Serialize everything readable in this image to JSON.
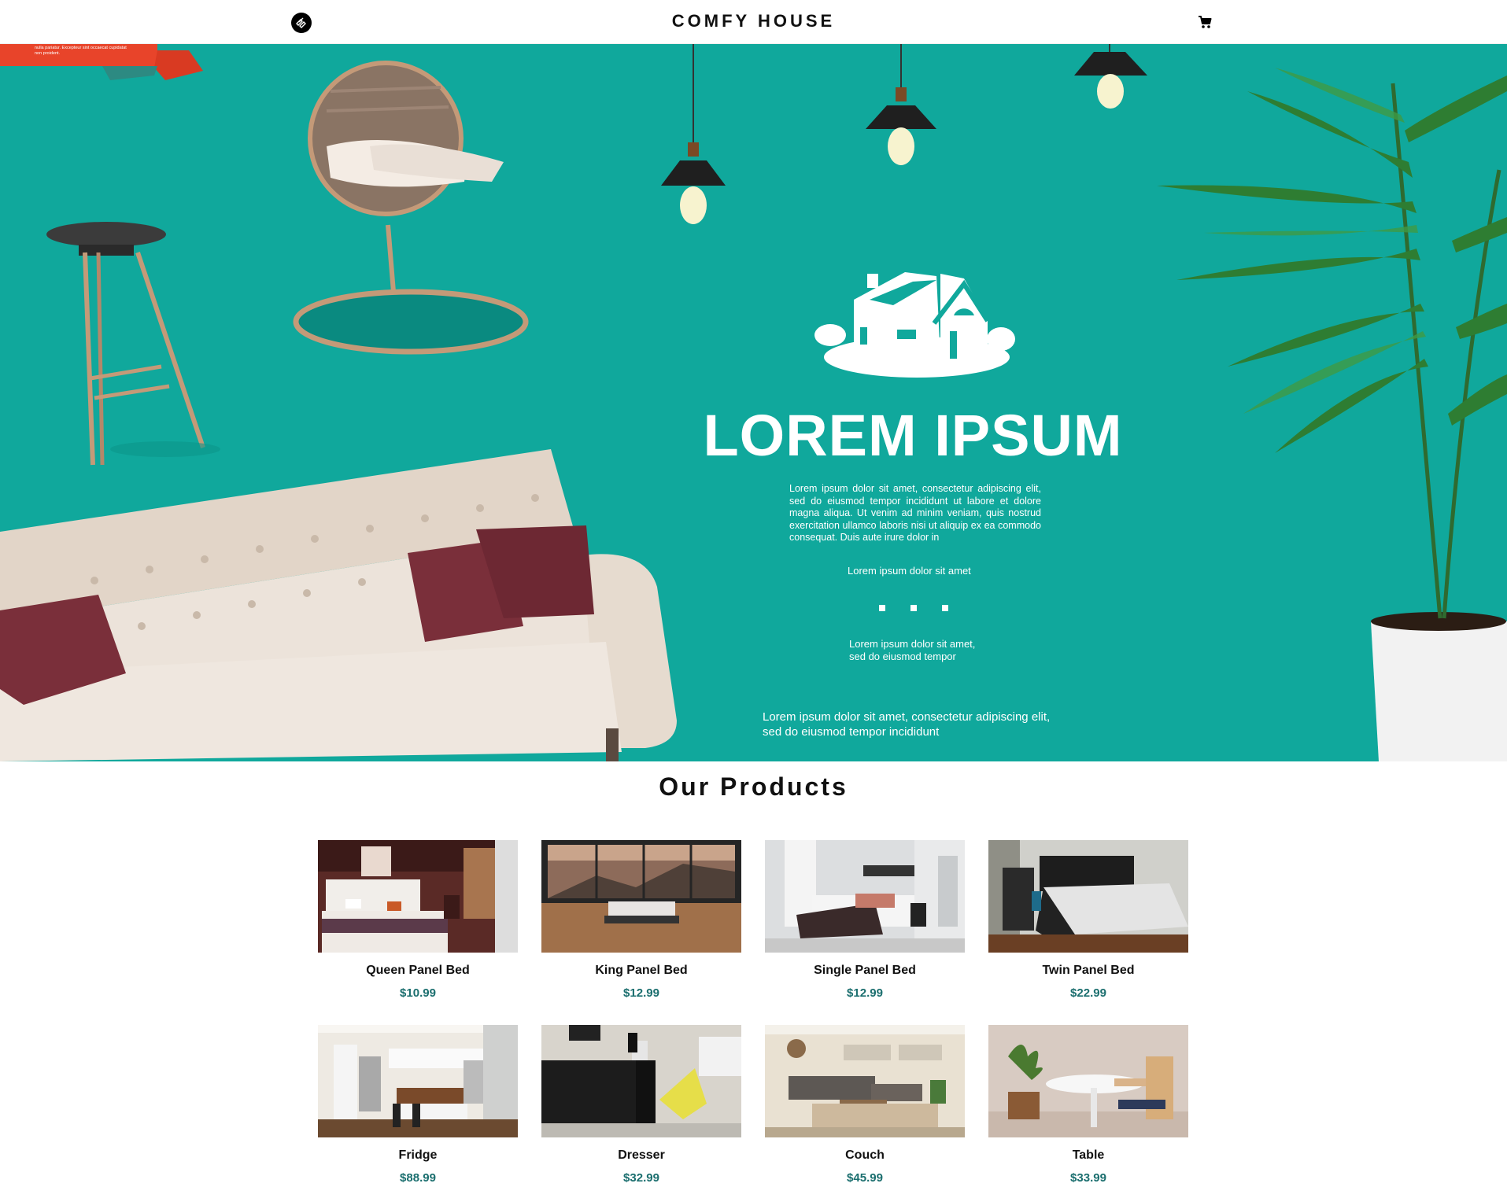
{
  "navbar": {
    "logo_icon": "brand-logo-icon",
    "title": "COMFY HOUSE",
    "cart_icon": "cart-icon"
  },
  "hero": {
    "ribbon_text": "nulla pariatur. Excepteur sint occaecat cupidatat non proident.",
    "title": "LOREM IPSUM",
    "paragraph": "Lorem ipsum dolor sit amet, consectetur adipiscing elit, sed do eiusmod tempor incididunt ut labore et dolore magna aliqua. Ut venim ad minim veniam, quis nostrud exercitation ullamco laboris nisi ut aliquip ex ea commodo consequat. Duis aute irure dolor in",
    "caption1": "Lorem ipsum dolor sit amet",
    "caption2_line1": "Lorem ipsum dolor sit amet,",
    "caption2_line2": "sed do eiusmod tempor",
    "caption3_line1": "Lorem ipsum dolor sit amet, consectetur adipiscing elit,",
    "caption3_line2": "sed do eiusmod tempor incididunt",
    "colors": {
      "background": "#10a89c",
      "ribbon": "#e8442a"
    }
  },
  "products_section": {
    "title": "Our Products",
    "items": [
      {
        "name": "Queen Panel Bed",
        "price": "$10.99",
        "scene": "bedroom-dark"
      },
      {
        "name": "King Panel Bed",
        "price": "$12.99",
        "scene": "bedroom-window"
      },
      {
        "name": "Single Panel Bed",
        "price": "$12.99",
        "scene": "bedroom-white"
      },
      {
        "name": "Twin Panel Bed",
        "price": "$22.99",
        "scene": "bedroom-sunlit"
      },
      {
        "name": "Fridge",
        "price": "$88.99",
        "scene": "kitchen"
      },
      {
        "name": "Dresser",
        "price": "$32.99",
        "scene": "dresser-room"
      },
      {
        "name": "Couch",
        "price": "$45.99",
        "scene": "living-room"
      },
      {
        "name": "Table",
        "price": "$33.99",
        "scene": "table-chair"
      }
    ]
  }
}
